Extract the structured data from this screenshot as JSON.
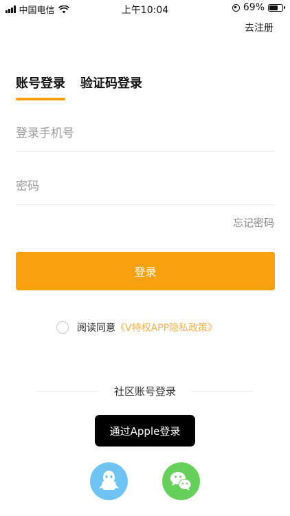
{
  "status_bar": {
    "carrier": "中国电信",
    "time": "上午10:04",
    "battery_percent": "69%",
    "battery_level": 0.69
  },
  "header": {
    "register_link": "去注册"
  },
  "tabs": [
    {
      "label": "账号登录",
      "active": true
    },
    {
      "label": "验证码登录",
      "active": false
    }
  ],
  "form": {
    "phone_placeholder": "登录手机号",
    "phone_value": "",
    "password_placeholder": "密码",
    "password_value": "",
    "forgot_password": "忘记密码",
    "login_button": "登录"
  },
  "agreement": {
    "checked": false,
    "text": "阅读同意",
    "policy_link": "《V特权APP隐私政策》"
  },
  "social": {
    "divider_label": "社区账号登录",
    "apple_button": "通过Apple登录",
    "providers": [
      "qq-icon",
      "wechat-icon"
    ]
  },
  "colors": {
    "accent": "#f8a10f",
    "policy_link": "#f3b14a",
    "qq": "#6ec3f0",
    "wechat": "#65d15b",
    "apple_button": "#000000"
  }
}
